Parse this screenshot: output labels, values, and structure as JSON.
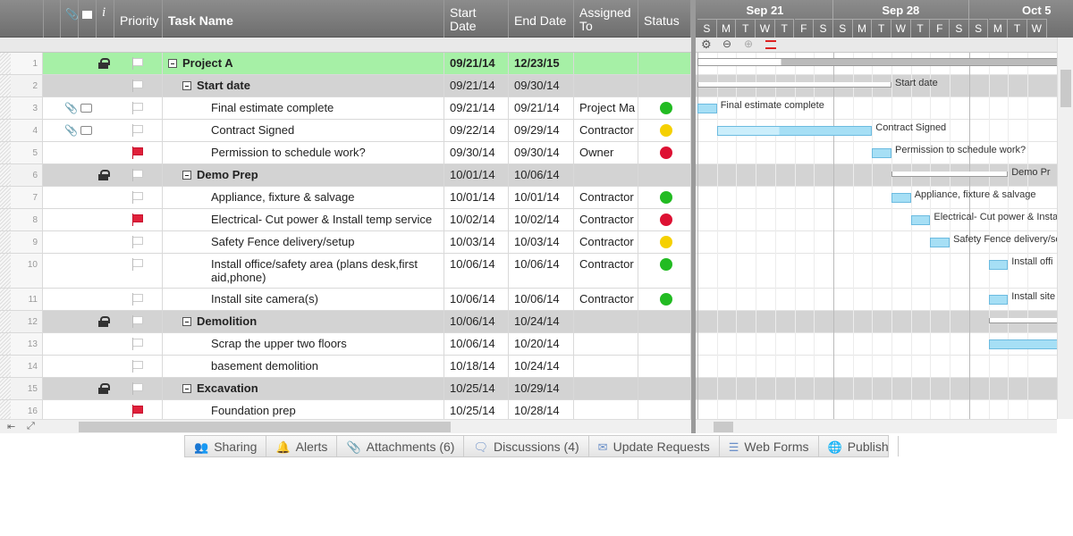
{
  "columns": {
    "priority": "Priority",
    "task": "Task Name",
    "start": "Start\nDate",
    "end": "End Date",
    "assigned": "Assigned\nTo",
    "status": "Status",
    "info": "i"
  },
  "gantt": {
    "weeks": [
      "Sep 21",
      "Sep 28",
      "Oct 5"
    ],
    "days": [
      "S",
      "M",
      "T",
      "W",
      "T",
      "F",
      "S",
      "S",
      "M",
      "T",
      "W",
      "T",
      "F",
      "S",
      "S",
      "M",
      "T",
      "W"
    ]
  },
  "rows": [
    {
      "num": "1",
      "name": "Project A",
      "start": "09/21/14",
      "end": "12/23/15",
      "assigned": "",
      "status": "",
      "type": "top",
      "lock": true,
      "flag": "white"
    },
    {
      "num": "2",
      "name": "Start date",
      "start": "09/21/14",
      "end": "09/30/14",
      "assigned": "",
      "status": "",
      "type": "group",
      "lock": false,
      "flag": "white"
    },
    {
      "num": "3",
      "name": "Final estimate complete",
      "start": "09/21/14",
      "end": "09/21/14",
      "assigned": "Project Ma",
      "status": "green",
      "type": "task",
      "attach": true,
      "flag": "white"
    },
    {
      "num": "4",
      "name": "Contract Signed",
      "start": "09/22/14",
      "end": "09/29/14",
      "assigned": "Contractor",
      "status": "yellow",
      "type": "task",
      "attach": true,
      "flag": "white"
    },
    {
      "num": "5",
      "name": "Permission to schedule work?",
      "start": "09/30/14",
      "end": "09/30/14",
      "assigned": "Owner",
      "status": "red",
      "type": "task",
      "flag": "red"
    },
    {
      "num": "6",
      "name": "Demo Prep",
      "start": "10/01/14",
      "end": "10/06/14",
      "assigned": "",
      "status": "",
      "type": "group",
      "lock": true,
      "flag": "white"
    },
    {
      "num": "7",
      "name": "Appliance, fixture & salvage",
      "start": "10/01/14",
      "end": "10/01/14",
      "assigned": "Contractor",
      "status": "green",
      "type": "task",
      "flag": "white"
    },
    {
      "num": "8",
      "name": "Electrical- Cut power & Install temp service",
      "start": "10/02/14",
      "end": "10/02/14",
      "assigned": "Contractor",
      "status": "red",
      "type": "task",
      "flag": "red"
    },
    {
      "num": "9",
      "name": "Safety Fence delivery/setup",
      "start": "10/03/14",
      "end": "10/03/14",
      "assigned": "Contractor",
      "status": "yellow",
      "type": "task",
      "flag": "white"
    },
    {
      "num": "10",
      "name": "Install office/safety area (plans desk,first",
      "name2": "aid,phone)",
      "start": "10/06/14",
      "end": "10/06/14",
      "assigned": "Contractor",
      "status": "green",
      "type": "task",
      "flag": "white"
    },
    {
      "num": "11",
      "name": "Install site camera(s)",
      "start": "10/06/14",
      "end": "10/06/14",
      "assigned": "Contractor",
      "status": "green",
      "type": "task",
      "flag": "white"
    },
    {
      "num": "12",
      "name": "Demolition",
      "start": "10/06/14",
      "end": "10/24/14",
      "assigned": "",
      "status": "",
      "type": "group",
      "lock": true,
      "flag": "white"
    },
    {
      "num": "13",
      "name": "Scrap the upper two floors",
      "start": "10/06/14",
      "end": "10/20/14",
      "assigned": "",
      "status": "",
      "type": "task",
      "flag": "white"
    },
    {
      "num": "14",
      "name": "basement demolition",
      "start": "10/18/14",
      "end": "10/24/14",
      "assigned": "",
      "status": "",
      "type": "task",
      "flag": "white"
    },
    {
      "num": "15",
      "name": "Excavation",
      "start": "10/25/14",
      "end": "10/29/14",
      "assigned": "",
      "status": "",
      "type": "group",
      "lock": true,
      "flag": "white"
    },
    {
      "num": "16",
      "name": "Foundation prep",
      "start": "10/25/14",
      "end": "10/28/14",
      "assigned": "",
      "status": "",
      "type": "task",
      "flag": "red"
    }
  ],
  "gantt_labels": {
    "r2": "Start date",
    "r3": "Final estimate complete",
    "r4": "Contract Signed",
    "r5": "Permission to schedule work?",
    "r6": "Demo Pr",
    "r7": "Appliance, fixture & salvage",
    "r8": "Electrical- Cut power & Insta",
    "r9": "Safety Fence delivery/se",
    "r10": "Install offi",
    "r11": "Install site"
  },
  "tabs": [
    {
      "label": "Sharing",
      "icon": "users-icon"
    },
    {
      "label": "Alerts",
      "icon": "bell-icon"
    },
    {
      "label": "Attachments (6)",
      "icon": "paperclip-icon"
    },
    {
      "label": "Discussions (4)",
      "icon": "comment-icon"
    },
    {
      "label": "Update Requests",
      "icon": "mail-icon"
    },
    {
      "label": "Web Forms",
      "icon": "form-icon"
    },
    {
      "label": "Publish",
      "icon": "globe-icon"
    }
  ],
  "colors": {
    "green": "#22bb22",
    "yellow": "#f5d000",
    "red": "#dd1133",
    "top": "#a6f0a6",
    "group": "#d3d3d3"
  }
}
